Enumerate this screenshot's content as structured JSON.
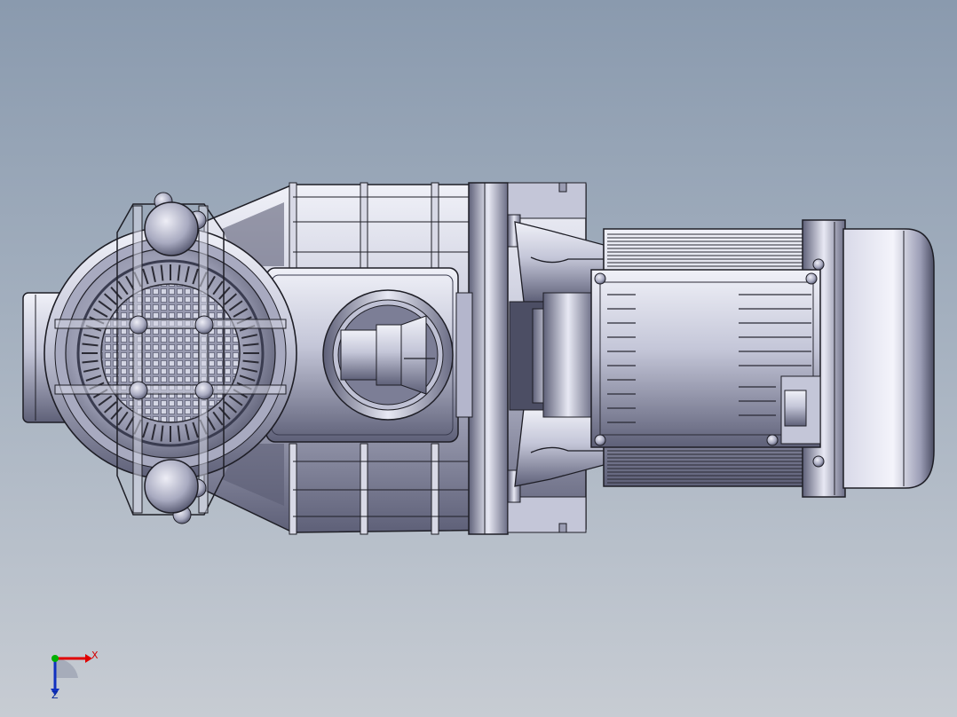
{
  "viewport": {
    "background_top": "#8a9aae",
    "background_bottom": "#c7ccd3"
  },
  "model": {
    "metal_light": "#e4e6f2",
    "metal_mid": "#b4b6cc",
    "metal_dark": "#6e7088",
    "outline": "#1e1e26",
    "grille_color": "#2a2a34"
  },
  "triad": {
    "x_label": "X",
    "z_label": "Z",
    "x_color": "#e00000",
    "y_color": "#00b000",
    "z_color": "#1030c0"
  }
}
